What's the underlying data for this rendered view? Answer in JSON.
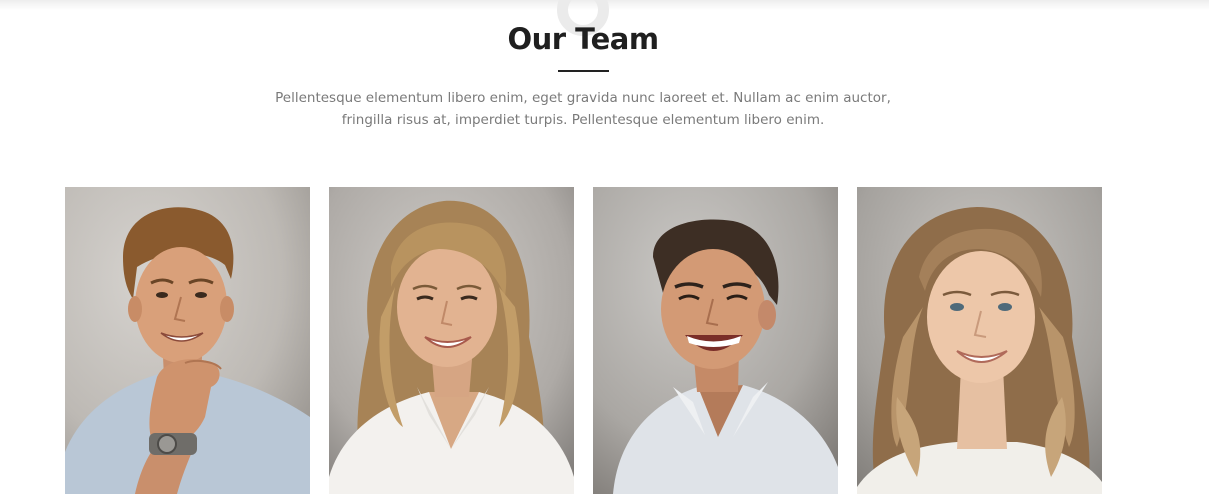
{
  "section": {
    "title": "Our Team",
    "description": "Pellentesque elementum libero enim, eget gravida nunc laoreet et. Nullam ac enim auctor, fringilla risus at, imperdiet turpis. Pellentesque elementum libero enim."
  },
  "colors": {
    "title": "#1f1f1f",
    "text": "#7a7a7a",
    "divider": "#222222",
    "background": "#ffffff"
  }
}
